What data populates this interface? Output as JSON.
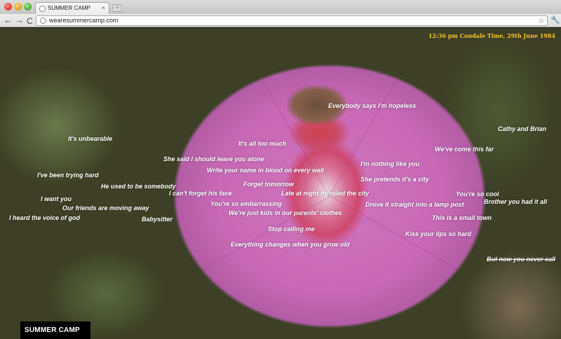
{
  "browser": {
    "tab_title": "SUMMER CAMP",
    "tab_close_glyph": "×",
    "new_tab_glyph": "+",
    "url": "wearesummercamp.com",
    "back_glyph": "←",
    "forward_glyph": "→",
    "reload_glyph": "C",
    "star_glyph": "☆",
    "wrench_glyph": "🔧"
  },
  "page": {
    "datetime": "12:36 pm Condale Time, 29th June 1984",
    "logo": "SUMMER CAMP",
    "lyrics": [
      "Everybody says I'm hopeless",
      "Cathy and Brian",
      "It's unbearable",
      "It's all too much",
      "We've come this far",
      "She said I should leave you alone",
      "I'm nothing like you",
      "Write your name in blood on every wall",
      "I've been trying hard",
      "She pretends it's a city",
      "Forget tomorrow",
      "He used to be somebody",
      "I can't forget his face",
      "Late at night he ruled the city",
      "You're so cool",
      "I want you",
      "Brother you had it all",
      "You're so embarrassing",
      "Drove it straight into a lamp post",
      "Our friends are moving away",
      "We're just kids in our parents' clothes",
      "I heard the voice of god",
      "Babysitter",
      "This is a small town",
      "Stop calling me",
      "Kiss your lips so hard",
      "Everything changes when you grow old",
      "But now you never call"
    ]
  },
  "colors": {
    "datetime": "#f5c32b",
    "lyric_text": "#ffffff",
    "logo_bg": "#000000"
  }
}
